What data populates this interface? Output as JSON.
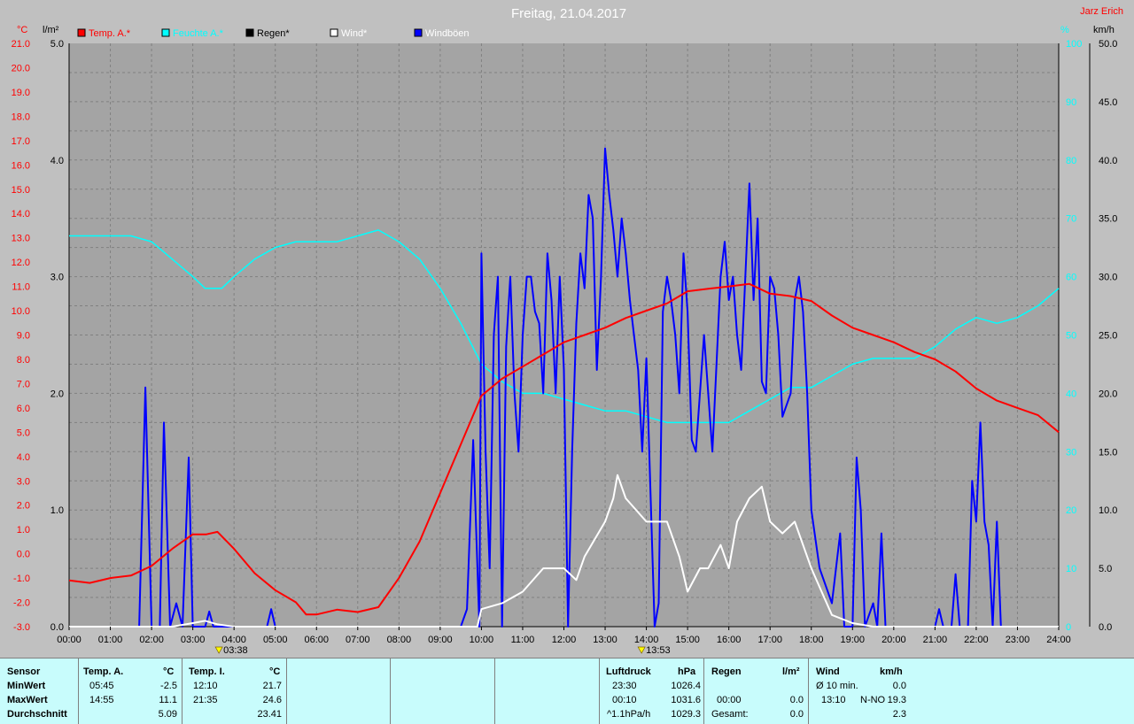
{
  "title": "Freitag, 21.04.2017",
  "author": "Jarz Erich",
  "colors": {
    "temp": "#ff0000",
    "hum": "#00ffff",
    "rain": "#000000",
    "wind": "#ffffff",
    "gust": "#0000ff",
    "plot_bg": "#a4a4a4",
    "grid": "#808080"
  },
  "legend": [
    "Temp. A.*",
    "Feuchte A.*",
    "Regen*",
    "Wind*",
    "Windböen"
  ],
  "axes": {
    "temp_unit": "°C",
    "rain_unit": "l/m²",
    "hum_unit": "%",
    "wind_unit": "km/h",
    "temp_ticks": [
      "-3.0",
      "-2.0",
      "-1.0",
      "0.0",
      "1.0",
      "2.0",
      "3.0",
      "4.0",
      "5.0",
      "6.0",
      "7.0",
      "8.0",
      "9.0",
      "10.0",
      "11.0",
      "12.0",
      "13.0",
      "14.0",
      "15.0",
      "16.0",
      "17.0",
      "18.0",
      "19.0",
      "20.0",
      "21.0"
    ],
    "rain_ticks": [
      "0.0",
      "1.0",
      "2.0",
      "3.0",
      "4.0",
      "5.0"
    ],
    "hum_ticks": [
      "0",
      "10",
      "20",
      "30",
      "40",
      "50",
      "60",
      "70",
      "80",
      "90",
      "100"
    ],
    "wind_ticks": [
      "0.0",
      "5.0",
      "10.0",
      "15.0",
      "20.0",
      "25.0",
      "30.0",
      "35.0",
      "40.0",
      "45.0",
      "50.0"
    ],
    "time_ticks": [
      "00:00",
      "01:00",
      "02:00",
      "03:00",
      "04:00",
      "05:00",
      "06:00",
      "07:00",
      "08:00",
      "09:00",
      "10:00",
      "11:00",
      "12:00",
      "13:00",
      "14:00",
      "15:00",
      "16:00",
      "17:00",
      "18:00",
      "19:00",
      "20:00",
      "21:00",
      "22:00",
      "23:00",
      "24:00"
    ]
  },
  "markers": [
    {
      "time": "03:38",
      "label": "03:38"
    },
    {
      "time": "13:53",
      "label": "13:53"
    }
  ],
  "chart_data": {
    "type": "line",
    "title": "Freitag, 21.04.2017",
    "x_unit": "hours since 00:00",
    "xlim": [
      0,
      24
    ],
    "series": [
      {
        "name": "Temp. A.*",
        "axis": "temp",
        "ylim": [
          -3,
          21
        ],
        "color": "#ff0000",
        "points": [
          [
            0,
            -1.1
          ],
          [
            0.5,
            -1.2
          ],
          [
            1,
            -1.0
          ],
          [
            1.5,
            -0.9
          ],
          [
            2,
            -0.5
          ],
          [
            2.5,
            0.2
          ],
          [
            3,
            0.8
          ],
          [
            3.33,
            0.8
          ],
          [
            3.6,
            0.9
          ],
          [
            4,
            0.2
          ],
          [
            4.5,
            -0.8
          ],
          [
            5,
            -1.5
          ],
          [
            5.5,
            -2.0
          ],
          [
            5.75,
            -2.5
          ],
          [
            6,
            -2.5
          ],
          [
            6.5,
            -2.3
          ],
          [
            7,
            -2.4
          ],
          [
            7.5,
            -2.2
          ],
          [
            8,
            -1.0
          ],
          [
            8.5,
            0.5
          ],
          [
            9,
            2.5
          ],
          [
            9.5,
            4.5
          ],
          [
            10,
            6.5
          ],
          [
            10.5,
            7.2
          ],
          [
            11,
            7.7
          ],
          [
            11.5,
            8.2
          ],
          [
            12,
            8.7
          ],
          [
            12.5,
            9.0
          ],
          [
            13,
            9.3
          ],
          [
            13.5,
            9.7
          ],
          [
            14,
            10.0
          ],
          [
            14.5,
            10.3
          ],
          [
            15,
            10.8
          ],
          [
            15.5,
            10.9
          ],
          [
            16,
            11.0
          ],
          [
            16.5,
            11.1
          ],
          [
            17,
            10.7
          ],
          [
            17.5,
            10.6
          ],
          [
            18,
            10.4
          ],
          [
            18.5,
            9.8
          ],
          [
            19,
            9.3
          ],
          [
            19.5,
            9.0
          ],
          [
            20,
            8.7
          ],
          [
            20.5,
            8.3
          ],
          [
            21,
            8.0
          ],
          [
            21.5,
            7.5
          ],
          [
            22,
            6.8
          ],
          [
            22.5,
            6.3
          ],
          [
            23,
            6.0
          ],
          [
            23.5,
            5.7
          ],
          [
            24,
            5.0
          ]
        ]
      },
      {
        "name": "Feuchte A.*",
        "axis": "hum",
        "ylim": [
          0,
          100
        ],
        "color": "#00ffff",
        "points": [
          [
            0,
            67
          ],
          [
            1,
            67
          ],
          [
            1.5,
            67
          ],
          [
            2,
            66
          ],
          [
            2.5,
            63
          ],
          [
            3,
            60
          ],
          [
            3.3,
            58
          ],
          [
            3.7,
            58
          ],
          [
            4,
            60
          ],
          [
            4.5,
            63
          ],
          [
            5,
            65
          ],
          [
            5.5,
            66
          ],
          [
            6,
            66
          ],
          [
            6.5,
            66
          ],
          [
            7,
            67
          ],
          [
            7.5,
            68
          ],
          [
            8,
            66
          ],
          [
            8.5,
            63
          ],
          [
            9,
            58
          ],
          [
            9.5,
            52
          ],
          [
            10,
            45
          ],
          [
            10.5,
            42
          ],
          [
            11,
            40
          ],
          [
            11.5,
            40
          ],
          [
            12,
            39
          ],
          [
            12.5,
            38
          ],
          [
            13,
            37
          ],
          [
            13.5,
            37
          ],
          [
            14,
            36
          ],
          [
            14.5,
            35
          ],
          [
            15,
            35
          ],
          [
            15.5,
            35
          ],
          [
            16,
            35
          ],
          [
            16.5,
            37
          ],
          [
            17,
            39
          ],
          [
            17.5,
            41
          ],
          [
            18,
            41
          ],
          [
            18.5,
            43
          ],
          [
            19,
            45
          ],
          [
            19.5,
            46
          ],
          [
            20,
            46
          ],
          [
            20.5,
            46
          ],
          [
            21,
            48
          ],
          [
            21.5,
            51
          ],
          [
            22,
            53
          ],
          [
            22.5,
            52
          ],
          [
            23,
            53
          ],
          [
            23.5,
            55
          ],
          [
            24,
            58
          ]
        ]
      },
      {
        "name": "Wind*",
        "axis": "wind",
        "ylim": [
          0,
          50
        ],
        "color": "#ffffff",
        "points": [
          [
            0,
            0
          ],
          [
            2,
            0
          ],
          [
            2.5,
            0
          ],
          [
            3,
            0.3
          ],
          [
            3.3,
            0.5
          ],
          [
            3.6,
            0.2
          ],
          [
            4,
            0
          ],
          [
            9.9,
            0
          ],
          [
            10,
            1.5
          ],
          [
            10.5,
            2
          ],
          [
            11,
            3
          ],
          [
            11.5,
            5
          ],
          [
            12,
            5
          ],
          [
            12.3,
            4
          ],
          [
            12.5,
            6
          ],
          [
            13,
            9
          ],
          [
            13.2,
            11
          ],
          [
            13.3,
            13
          ],
          [
            13.5,
            11
          ],
          [
            14,
            9
          ],
          [
            14.5,
            9
          ],
          [
            14.8,
            6
          ],
          [
            15,
            3
          ],
          [
            15.3,
            5
          ],
          [
            15.5,
            5
          ],
          [
            15.8,
            7
          ],
          [
            16,
            5
          ],
          [
            16.2,
            9
          ],
          [
            16.5,
            11
          ],
          [
            16.8,
            12
          ],
          [
            17,
            9
          ],
          [
            17.3,
            8
          ],
          [
            17.6,
            9
          ],
          [
            18,
            5
          ],
          [
            18.5,
            1
          ],
          [
            19,
            0.3
          ],
          [
            19.5,
            0
          ],
          [
            24,
            0
          ]
        ]
      },
      {
        "name": "Windböen",
        "axis": "wind",
        "ylim": [
          0,
          50
        ],
        "color": "#0000ff",
        "points": [
          [
            0,
            0
          ],
          [
            1.7,
            0
          ],
          [
            1.85,
            20.5
          ],
          [
            2.0,
            0
          ],
          [
            2.2,
            0
          ],
          [
            2.3,
            17.5
          ],
          [
            2.45,
            0
          ],
          [
            2.6,
            2
          ],
          [
            2.75,
            0
          ],
          [
            2.9,
            14.5
          ],
          [
            3.0,
            0
          ],
          [
            3.1,
            0
          ],
          [
            3.3,
            0
          ],
          [
            3.4,
            1.3
          ],
          [
            3.5,
            0
          ],
          [
            4,
            0
          ],
          [
            4.8,
            0
          ],
          [
            4.9,
            1.5
          ],
          [
            5.0,
            0
          ],
          [
            9.5,
            0
          ],
          [
            9.65,
            1.5
          ],
          [
            9.8,
            16
          ],
          [
            9.95,
            0
          ],
          [
            10.0,
            32
          ],
          [
            10.1,
            15
          ],
          [
            10.2,
            5
          ],
          [
            10.3,
            25
          ],
          [
            10.4,
            30
          ],
          [
            10.5,
            0
          ],
          [
            10.6,
            24
          ],
          [
            10.7,
            30
          ],
          [
            10.8,
            20
          ],
          [
            10.9,
            15
          ],
          [
            11.0,
            25
          ],
          [
            11.1,
            30
          ],
          [
            11.2,
            30
          ],
          [
            11.3,
            27
          ],
          [
            11.4,
            26
          ],
          [
            11.5,
            20
          ],
          [
            11.6,
            32
          ],
          [
            11.7,
            28
          ],
          [
            11.8,
            20
          ],
          [
            11.9,
            30
          ],
          [
            12.0,
            22
          ],
          [
            12.1,
            0
          ],
          [
            12.2,
            15
          ],
          [
            12.3,
            26
          ],
          [
            12.4,
            32
          ],
          [
            12.5,
            29
          ],
          [
            12.6,
            37
          ],
          [
            12.7,
            35
          ],
          [
            12.8,
            22
          ],
          [
            12.9,
            30
          ],
          [
            13.0,
            41
          ],
          [
            13.1,
            37
          ],
          [
            13.2,
            34
          ],
          [
            13.3,
            30
          ],
          [
            13.4,
            35
          ],
          [
            13.5,
            32
          ],
          [
            13.6,
            28
          ],
          [
            13.7,
            25
          ],
          [
            13.8,
            22
          ],
          [
            13.9,
            15
          ],
          [
            14.0,
            23
          ],
          [
            14.2,
            0
          ],
          [
            14.3,
            2
          ],
          [
            14.4,
            27
          ],
          [
            14.5,
            30
          ],
          [
            14.6,
            28
          ],
          [
            14.7,
            25
          ],
          [
            14.8,
            20
          ],
          [
            14.9,
            32
          ],
          [
            15.0,
            27
          ],
          [
            15.1,
            16
          ],
          [
            15.2,
            15
          ],
          [
            15.4,
            25
          ],
          [
            15.6,
            15
          ],
          [
            15.8,
            30
          ],
          [
            15.9,
            33
          ],
          [
            16.0,
            28
          ],
          [
            16.1,
            30
          ],
          [
            16.2,
            25
          ],
          [
            16.3,
            22
          ],
          [
            16.4,
            30
          ],
          [
            16.5,
            38
          ],
          [
            16.6,
            28
          ],
          [
            16.7,
            35
          ],
          [
            16.8,
            21
          ],
          [
            16.9,
            20
          ],
          [
            17.0,
            30
          ],
          [
            17.1,
            29
          ],
          [
            17.2,
            25
          ],
          [
            17.3,
            18
          ],
          [
            17.5,
            20
          ],
          [
            17.6,
            28
          ],
          [
            17.7,
            30
          ],
          [
            17.8,
            27
          ],
          [
            17.9,
            20
          ],
          [
            18.0,
            10
          ],
          [
            18.2,
            5
          ],
          [
            18.5,
            2
          ],
          [
            18.7,
            8
          ],
          [
            18.8,
            0
          ],
          [
            19.0,
            0
          ],
          [
            19.1,
            14.5
          ],
          [
            19.2,
            10
          ],
          [
            19.3,
            0
          ],
          [
            19.5,
            2
          ],
          [
            19.6,
            0
          ],
          [
            19.7,
            8
          ],
          [
            19.8,
            0
          ],
          [
            20.0,
            0
          ],
          [
            21.0,
            0
          ],
          [
            21.1,
            1.5
          ],
          [
            21.2,
            0
          ],
          [
            21.4,
            0
          ],
          [
            21.5,
            4.5
          ],
          [
            21.6,
            0
          ],
          [
            21.8,
            0
          ],
          [
            21.9,
            12.5
          ],
          [
            22.0,
            9
          ],
          [
            22.1,
            17.5
          ],
          [
            22.2,
            9
          ],
          [
            22.3,
            7
          ],
          [
            22.4,
            0
          ],
          [
            22.5,
            9
          ],
          [
            22.6,
            0
          ],
          [
            23,
            0
          ],
          [
            24,
            0
          ]
        ]
      },
      {
        "name": "Regen*",
        "axis": "rain",
        "ylim": [
          0,
          5
        ],
        "color": "#000000",
        "points": [
          [
            0,
            0
          ],
          [
            24,
            0
          ]
        ]
      }
    ]
  },
  "stats": {
    "sensor": {
      "header": "Sensor",
      "rows": [
        "MinWert",
        "MaxWert",
        "Durchschnitt"
      ]
    },
    "temp_a": {
      "header": "Temp. A.",
      "unit": "°C",
      "min_time": "05:45",
      "min": "-2.5",
      "max_time": "14:55",
      "max": "11.1",
      "avg": "5.09"
    },
    "temp_i": {
      "header": "Temp. I.",
      "unit": "°C",
      "min_time": "12:10",
      "min": "21.7",
      "max_time": "21:35",
      "max": "24.6",
      "avg": "23.41"
    },
    "pressure": {
      "header": "Luftdruck",
      "unit": "hPa",
      "min_time": "23:30",
      "min": "1026.4",
      "max_time": "00:10",
      "max": "1031.6",
      "trend": "^1.1hPa/h",
      "avg": "1029.3"
    },
    "rain": {
      "header": "Regen",
      "unit": "l/m²",
      "min_time": "",
      "min": "",
      "max_time": "00:00",
      "max": "0.0",
      "total_label": "Gesamt:",
      "total": "0.0"
    },
    "wind": {
      "header": "Wind",
      "unit": "km/h",
      "avg_label": "Ø 10 min.",
      "avg10": "0.0",
      "max_time": "13:10",
      "max_dir": "N-NO",
      "max": "19.3",
      "avg": "2.3"
    }
  }
}
